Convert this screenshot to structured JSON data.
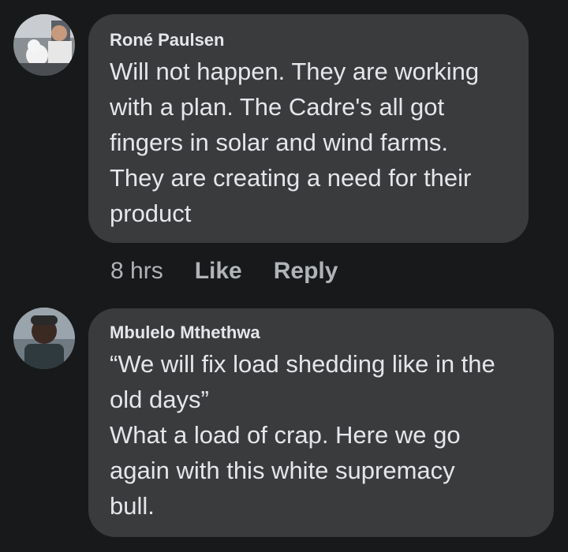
{
  "comments": [
    {
      "author": "Roné Paulsen",
      "text": "Will not happen. They are working\nwith a plan. The Cadre's all got\nfingers in solar and wind farms.\nThey are creating a need for their\nproduct",
      "time": "8 hrs",
      "like_label": "Like",
      "reply_label": "Reply"
    },
    {
      "author": "Mbulelo Mthethwa",
      "text": "“We will fix load shedding like in the\nold days”\nWhat a load of crap. Here we go\nagain with this white supremacy\nbull."
    }
  ],
  "colors": {
    "background": "#18191a",
    "bubble": "#3a3b3c",
    "primary_text": "#e4e6eb",
    "secondary_text": "#b0b3b8"
  }
}
